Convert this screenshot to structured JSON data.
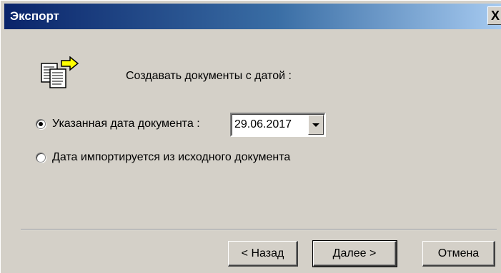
{
  "window": {
    "title": "Экспорт",
    "close_symbol": "X"
  },
  "content": {
    "icon": "documents-export-icon",
    "caption": "Создавать документы с датой :",
    "options": [
      {
        "label": "Указанная дата документа :",
        "checked": true
      },
      {
        "label": "Дата импортируется из исходного документа",
        "checked": false
      }
    ],
    "date_value": "29.06.2017"
  },
  "footer": {
    "back_label": "< Назад",
    "next_label": "Далее >",
    "cancel_label": "Отмена"
  },
  "colors": {
    "face": "#d4d0c8",
    "title_start": "#0a246a",
    "title_end": "#a6caf0"
  }
}
